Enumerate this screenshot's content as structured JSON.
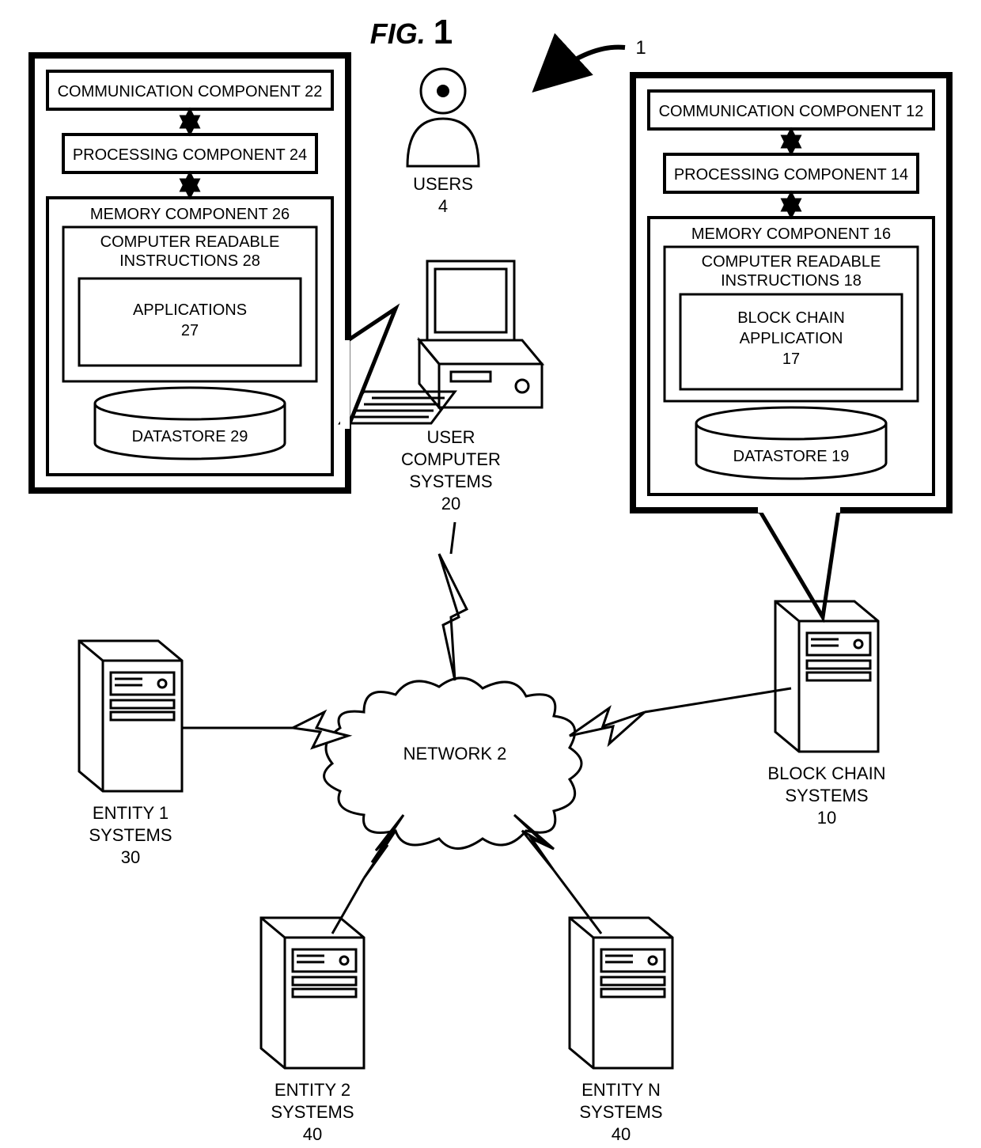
{
  "figure": {
    "label": "FIG.",
    "number": "1",
    "ref": "1"
  },
  "users": {
    "label": "USERS",
    "num": "4"
  },
  "user_computer": {
    "l1": "USER",
    "l2": "COMPUTER",
    "l3": "SYSTEMS",
    "num": "20"
  },
  "network": {
    "label": "NETWORK",
    "num": "2"
  },
  "block_chain_systems": {
    "l1": "BLOCK CHAIN",
    "l2": "SYSTEMS",
    "num": "10"
  },
  "entity1": {
    "l1": "ENTITY 1",
    "l2": "SYSTEMS",
    "num": "30"
  },
  "entity2": {
    "l1": "ENTITY 2",
    "l2": "SYSTEMS",
    "num": "40"
  },
  "entityN": {
    "l1": "ENTITY N",
    "l2": "SYSTEMS",
    "num": "40"
  },
  "left_box": {
    "comm": "COMMUNICATION COMPONENT 22",
    "proc": "PROCESSING COMPONENT 24",
    "mem": "MEMORY COMPONENT 26",
    "cri": "COMPUTER READABLE",
    "cri2": "INSTRUCTIONS 28",
    "app": "APPLICATIONS",
    "appn": "27",
    "ds": "DATASTORE 29"
  },
  "right_box": {
    "comm": "COMMUNICATION COMPONENT 12",
    "proc": "PROCESSING COMPONENT  14",
    "mem": "MEMORY COMPONENT  16",
    "cri": "COMPUTER READABLE",
    "cri2": "INSTRUCTIONS 18",
    "app": "BLOCK CHAIN",
    "app2": "APPLICATION",
    "appn": "17",
    "ds": "DATASTORE 19"
  }
}
